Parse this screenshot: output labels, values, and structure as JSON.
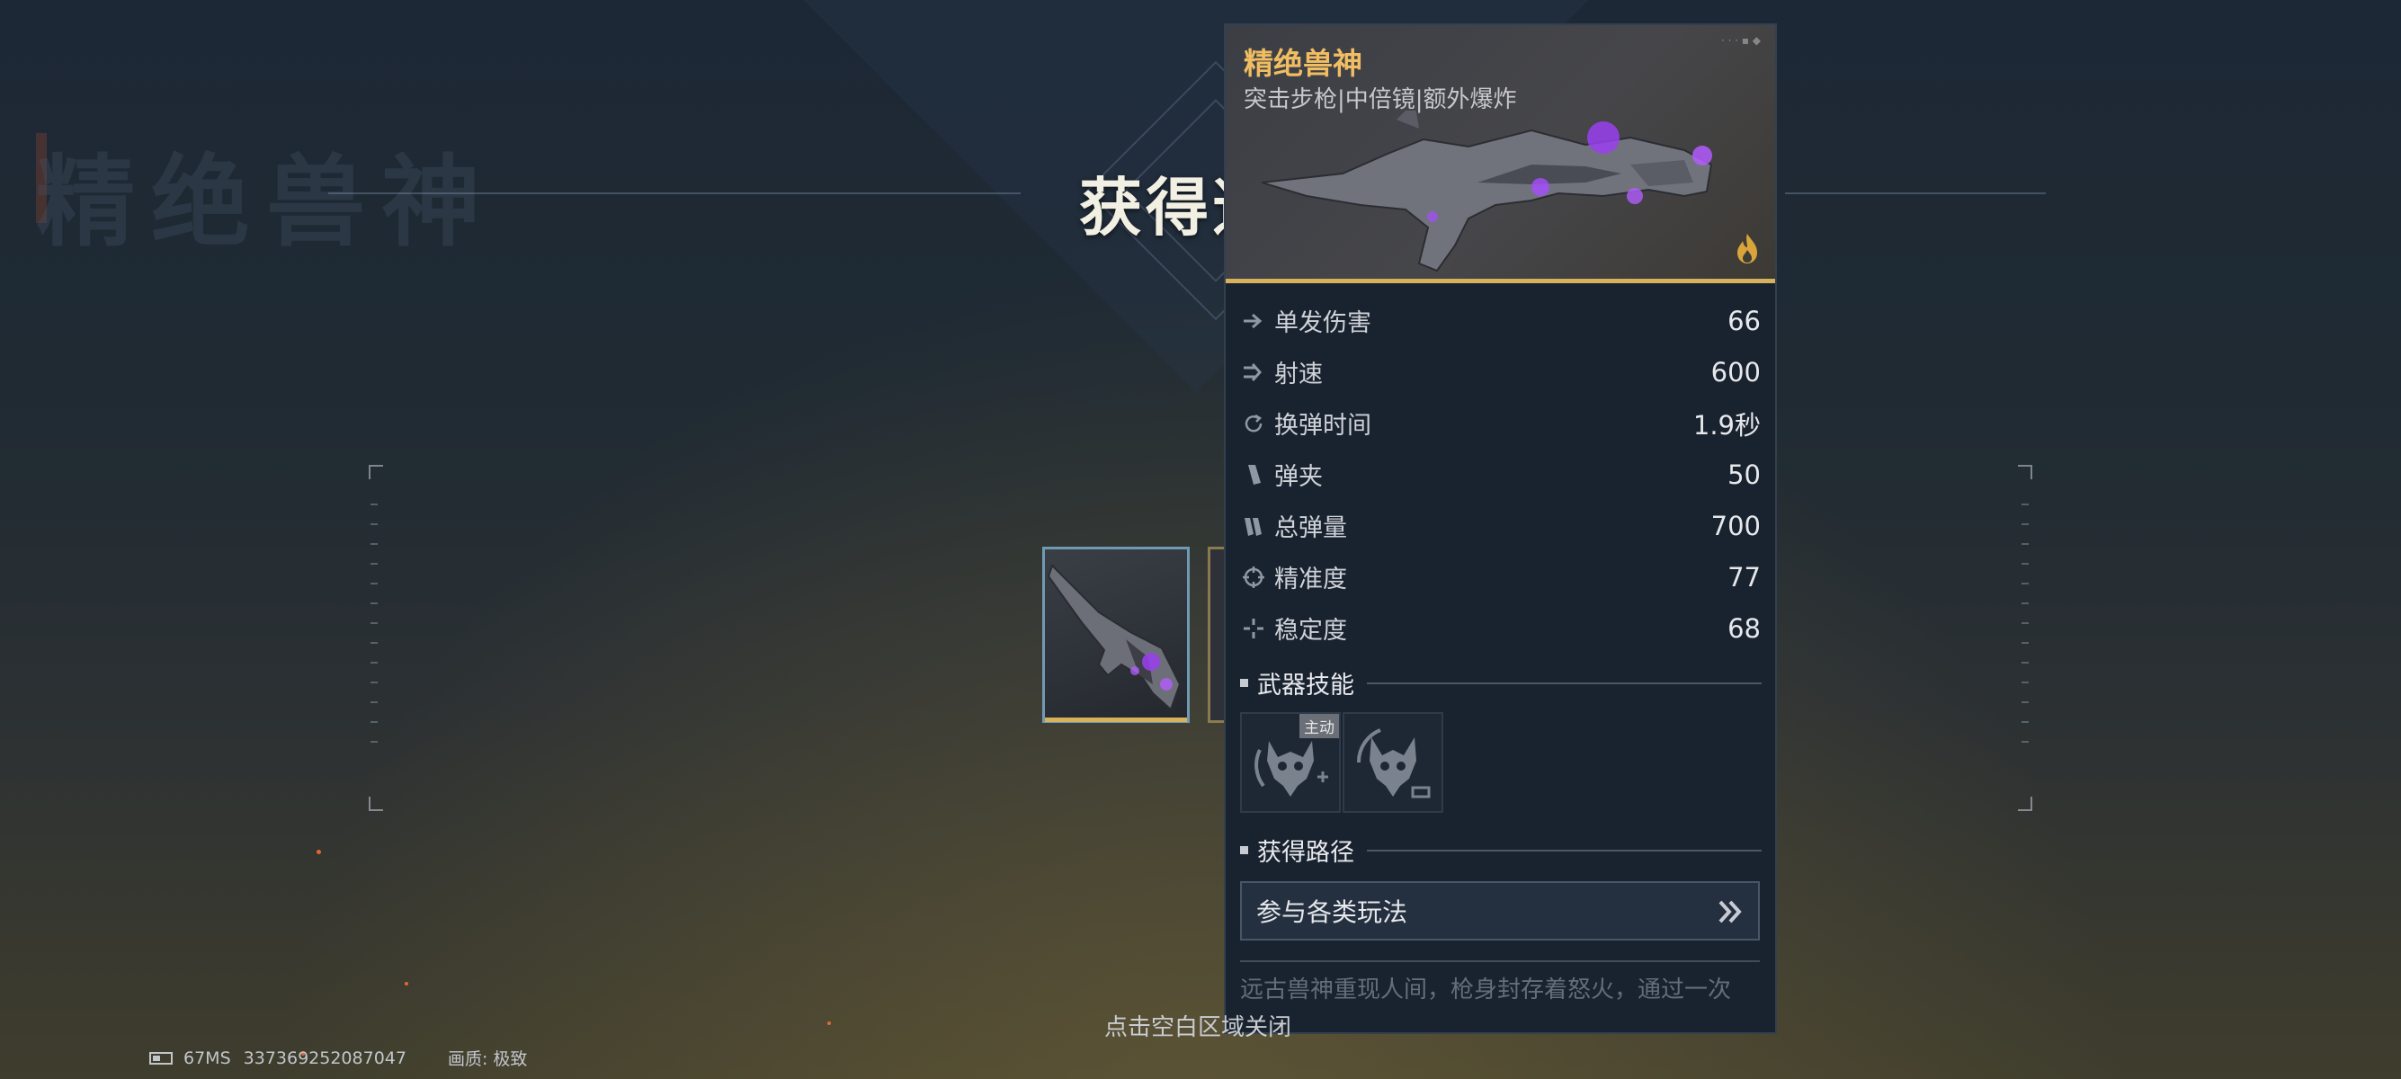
{
  "background": {
    "ghost_title": "精绝兽神",
    "header_title": "获得道具"
  },
  "item_card": {
    "name": "精绝兽神",
    "type_line": "突击步枪|中倍镜|额外爆炸",
    "rarity_color": "#d7b15b",
    "stats": [
      {
        "icon": "damage-icon",
        "label": "单发伤害",
        "value": "66"
      },
      {
        "icon": "fire-rate-icon",
        "label": "射速",
        "value": "600"
      },
      {
        "icon": "reload-icon",
        "label": "换弹时间",
        "value": "1.9秒"
      },
      {
        "icon": "magazine-icon",
        "label": "弹夹",
        "value": "50"
      },
      {
        "icon": "total-ammo-icon",
        "label": "总弹量",
        "value": "700"
      },
      {
        "icon": "crosshair-icon",
        "label": "精准度",
        "value": "77"
      },
      {
        "icon": "stability-icon",
        "label": "稳定度",
        "value": "68"
      }
    ],
    "skills_title": "武器技能",
    "skills": [
      {
        "icon": "beast-skull-skill-icon",
        "badge": "主动"
      },
      {
        "icon": "beast-skull-skill-icon-2",
        "badge": ""
      }
    ],
    "source_title": "获得路径",
    "source_button": "参与各类玩法",
    "description": "远古兽神重现人间，枪身封存着怒火，通过一次"
  },
  "hint": "点击空白区域关闭",
  "status_bar": {
    "ping": "67MS",
    "uid": "337369252087047",
    "quality_label": "画质:",
    "quality_value": "极致"
  }
}
